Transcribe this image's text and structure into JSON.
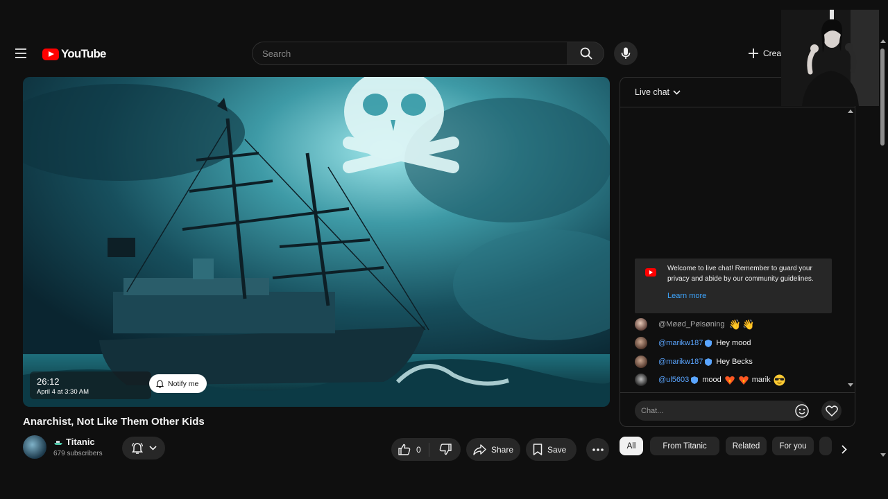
{
  "header": {
    "logo_text": "YouTube",
    "search_placeholder": "Search",
    "create_label": "Crea"
  },
  "video": {
    "title": "Anarchist, Not Like Them Other Kids",
    "duration": "26:12",
    "premiere_date": "April 4 at 3:30 AM",
    "notify_label": "Notify me"
  },
  "channel": {
    "name": "Titanic",
    "subscribers": "679 subscribers"
  },
  "actions": {
    "like_count": "0",
    "share_label": "Share",
    "save_label": "Save"
  },
  "chat": {
    "mode_label": "Live chat",
    "welcome_text": "Welcome to live chat! Remember to guard your privacy and abide by our community guidelines.",
    "learn_more": "Learn more",
    "messages": [
      {
        "author": "@Møød_Pøisøning",
        "text": "",
        "emoji": "👋👋",
        "member": false
      },
      {
        "author": "@marikw187",
        "text": "Hey mood",
        "emoji": "",
        "member": true
      },
      {
        "author": "@marikw187",
        "text": "Hey Becks",
        "emoji": "",
        "member": true
      },
      {
        "author": "@ul5603",
        "text": "mood",
        "text2": "marik",
        "emoji": "",
        "member": true
      }
    ],
    "input_placeholder": "Chat..."
  },
  "chips": [
    {
      "label": "All",
      "active": true
    },
    {
      "label": "From Titanic",
      "active": false
    },
    {
      "label": "Related",
      "active": false
    },
    {
      "label": "For you",
      "active": false
    }
  ],
  "colors": {
    "background": "#0f0f0f",
    "brand_red": "#ff0000",
    "link_blue": "#3ea6ff",
    "surface": "#272727"
  },
  "icons": [
    "menu-icon",
    "search-icon",
    "mic-icon",
    "plus-icon",
    "bell-icon",
    "like-icon",
    "dislike-icon",
    "share-icon",
    "save-icon",
    "more-icon",
    "emoji-icon",
    "heart-icon",
    "chevron-down-icon",
    "chevron-right-icon"
  ]
}
